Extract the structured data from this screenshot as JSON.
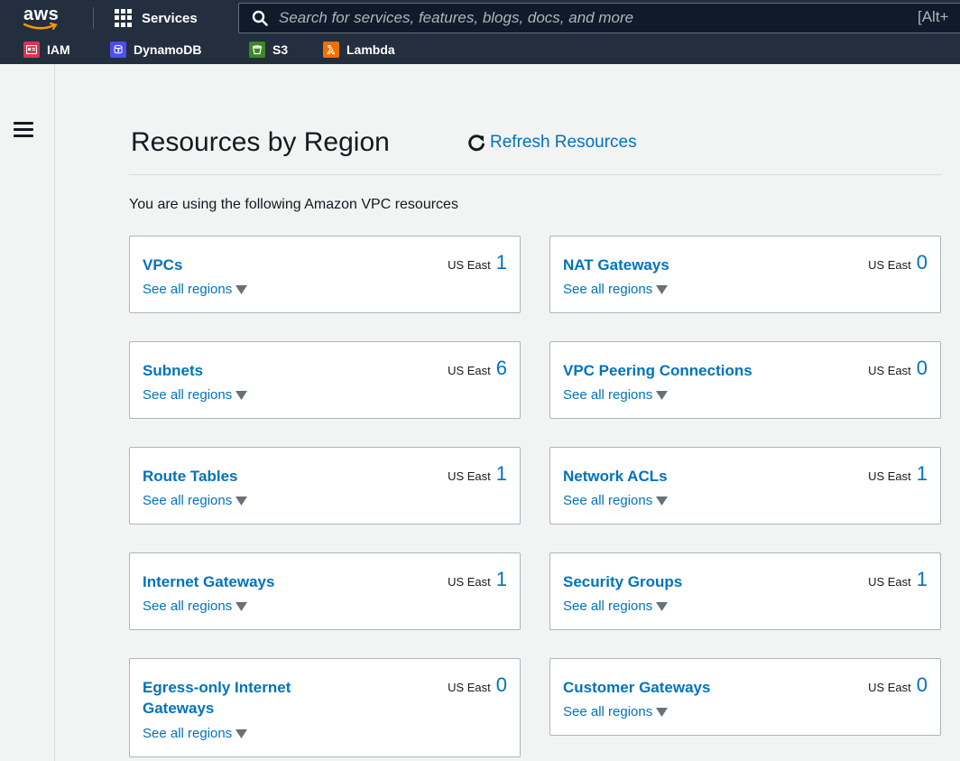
{
  "nav": {
    "logo_text": "aws",
    "services_label": "Services",
    "search_placeholder": "Search for services, features, blogs, docs, and more",
    "search_shortcut": "[Alt+"
  },
  "favorites": [
    {
      "label": "IAM",
      "icon": "iam-icon",
      "color": "#dd344c"
    },
    {
      "label": "DynamoDB",
      "icon": "dynamodb-icon",
      "color": "#4d4df5"
    },
    {
      "label": "S3",
      "icon": "s3-icon",
      "color": "#3f8624"
    },
    {
      "label": "Lambda",
      "icon": "lambda-icon",
      "color": "#ed7100"
    }
  ],
  "page": {
    "title": "Resources by Region",
    "refresh_label": "Refresh Resources",
    "intro": "You are using the following Amazon VPC resources"
  },
  "region_label": "US East",
  "see_all_label": "See all regions",
  "resources": [
    {
      "name": "VPCs",
      "count": "1"
    },
    {
      "name": "NAT Gateways",
      "count": "0"
    },
    {
      "name": "Subnets",
      "count": "6"
    },
    {
      "name": "VPC Peering Connections",
      "count": "0"
    },
    {
      "name": "Route Tables",
      "count": "1"
    },
    {
      "name": "Network ACLs",
      "count": "1"
    },
    {
      "name": "Internet Gateways",
      "count": "1"
    },
    {
      "name": "Security Groups",
      "count": "1"
    },
    {
      "name": "Egress-only Internet Gateways",
      "count": "0"
    },
    {
      "name": "Customer Gateways",
      "count": "0"
    }
  ],
  "colors": {
    "nav_bg": "#232f3e",
    "link": "#0073bb",
    "page_bg": "#f2f3f3"
  }
}
